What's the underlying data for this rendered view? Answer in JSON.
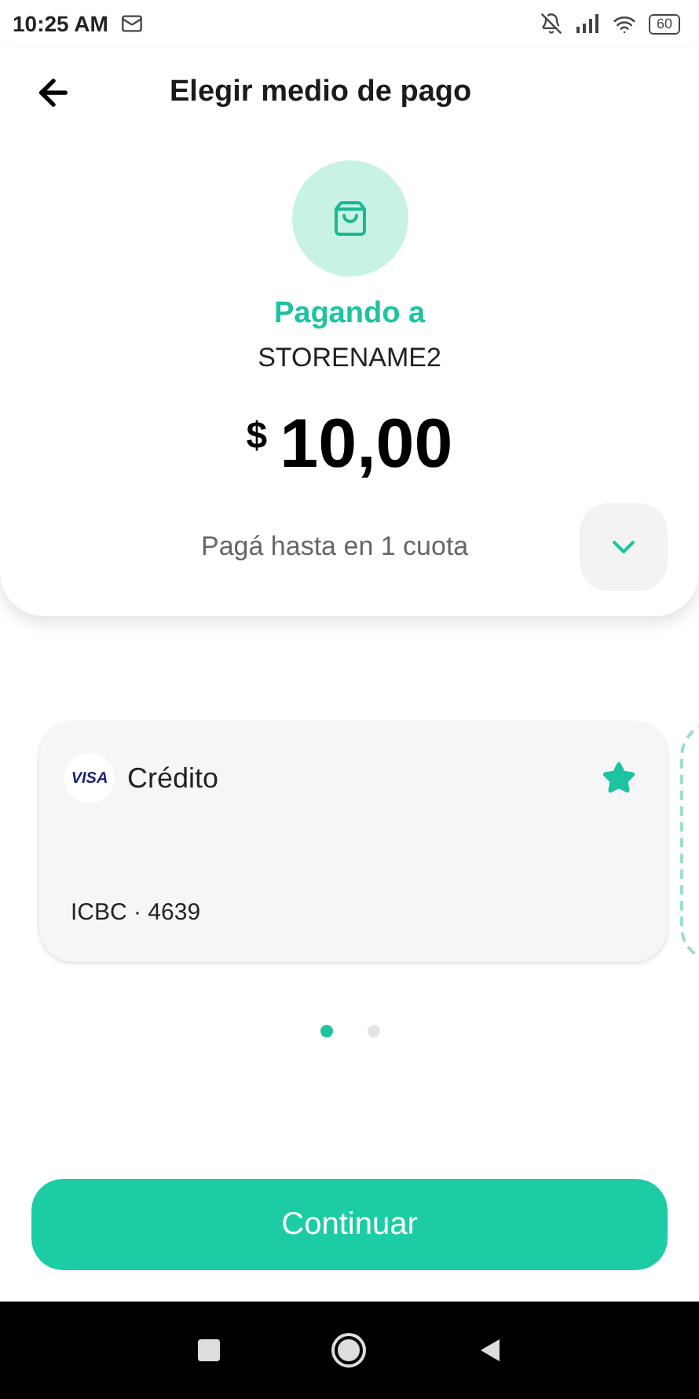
{
  "status_bar": {
    "time": "10:25 AM",
    "battery": "60"
  },
  "header": {
    "title": "Elegir medio de pago"
  },
  "payee": {
    "label": "Pagando a",
    "name": "STORENAME2"
  },
  "amount": {
    "currency": "$",
    "value": "10,00"
  },
  "installments": {
    "text": "Pagá hasta en 1 cuota",
    "expanded": false
  },
  "cards": [
    {
      "kind": "card",
      "brand": "VISA",
      "type": "Crédito",
      "account": "ICBC · 4639",
      "favorite": true
    },
    {
      "kind": "placeholder"
    }
  ],
  "pager": [
    {
      "selected": true
    },
    {
      "selected": false
    }
  ],
  "continue_button": "Continuar"
}
